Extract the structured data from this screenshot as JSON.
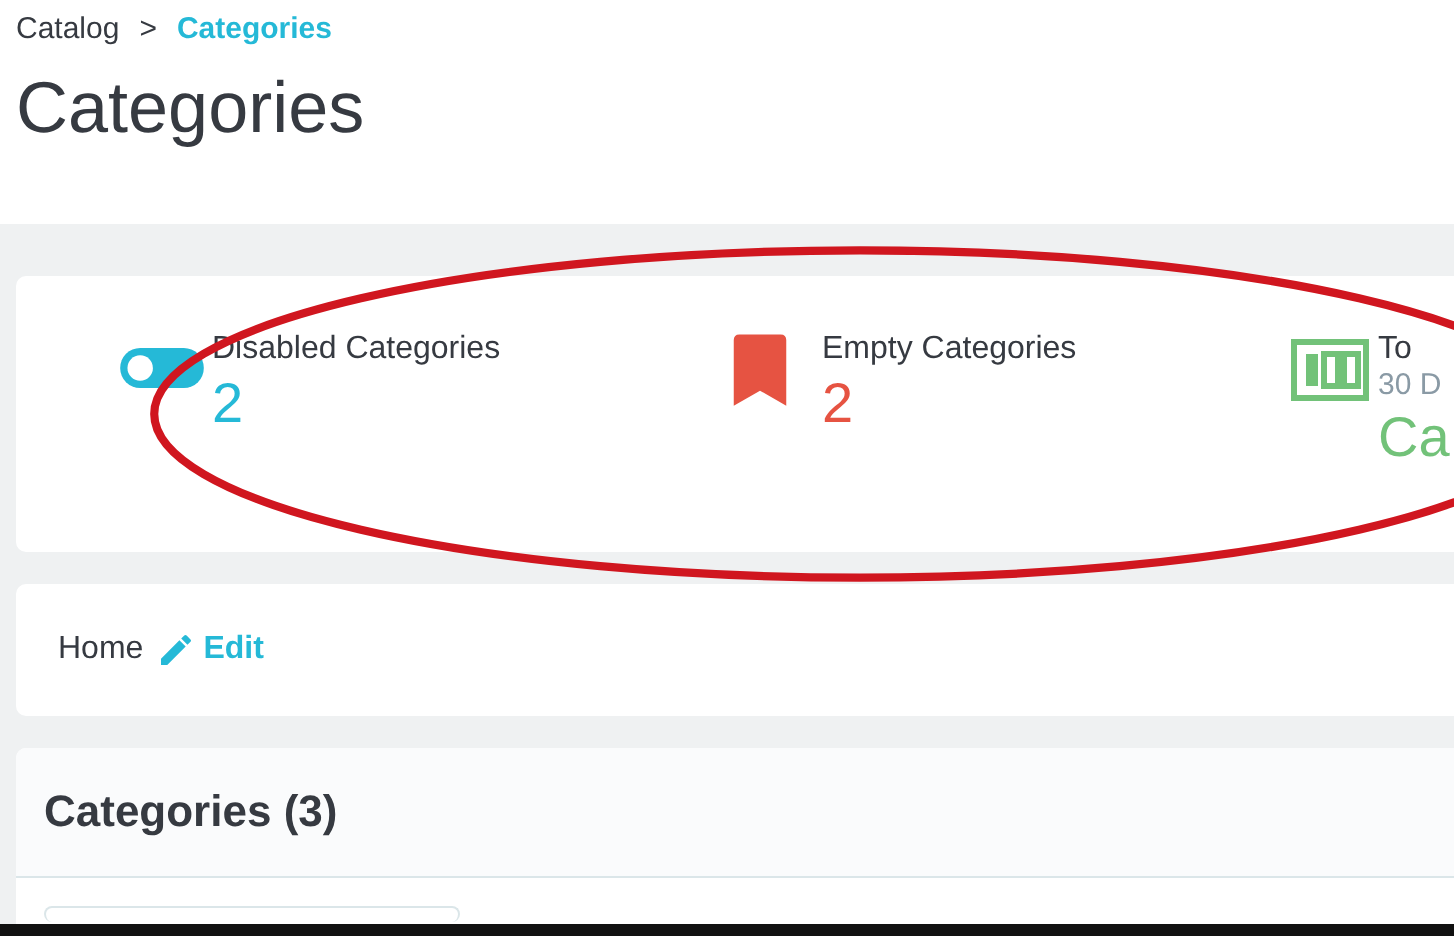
{
  "breadcrumb": [
    {
      "label": "Catalog",
      "selected": false
    },
    {
      "label": "Categories",
      "selected": true
    }
  ],
  "breadcrumb_separator": ">",
  "title": "Categories",
  "kpis": [
    {
      "kind": "toggle",
      "label": "Disabled Categories",
      "value": "2",
      "color": "#25b9d7"
    },
    {
      "kind": "bookmark",
      "label": "Empty Categories",
      "value": "2",
      "color": "#e65342"
    },
    {
      "kind": "counter",
      "label": "To",
      "sublabel": "30 D",
      "value": "Ca",
      "color": "#72c279"
    }
  ],
  "category_path": {
    "label": "Home",
    "action": "Edit"
  },
  "panel": {
    "title": "Categories (3)"
  }
}
